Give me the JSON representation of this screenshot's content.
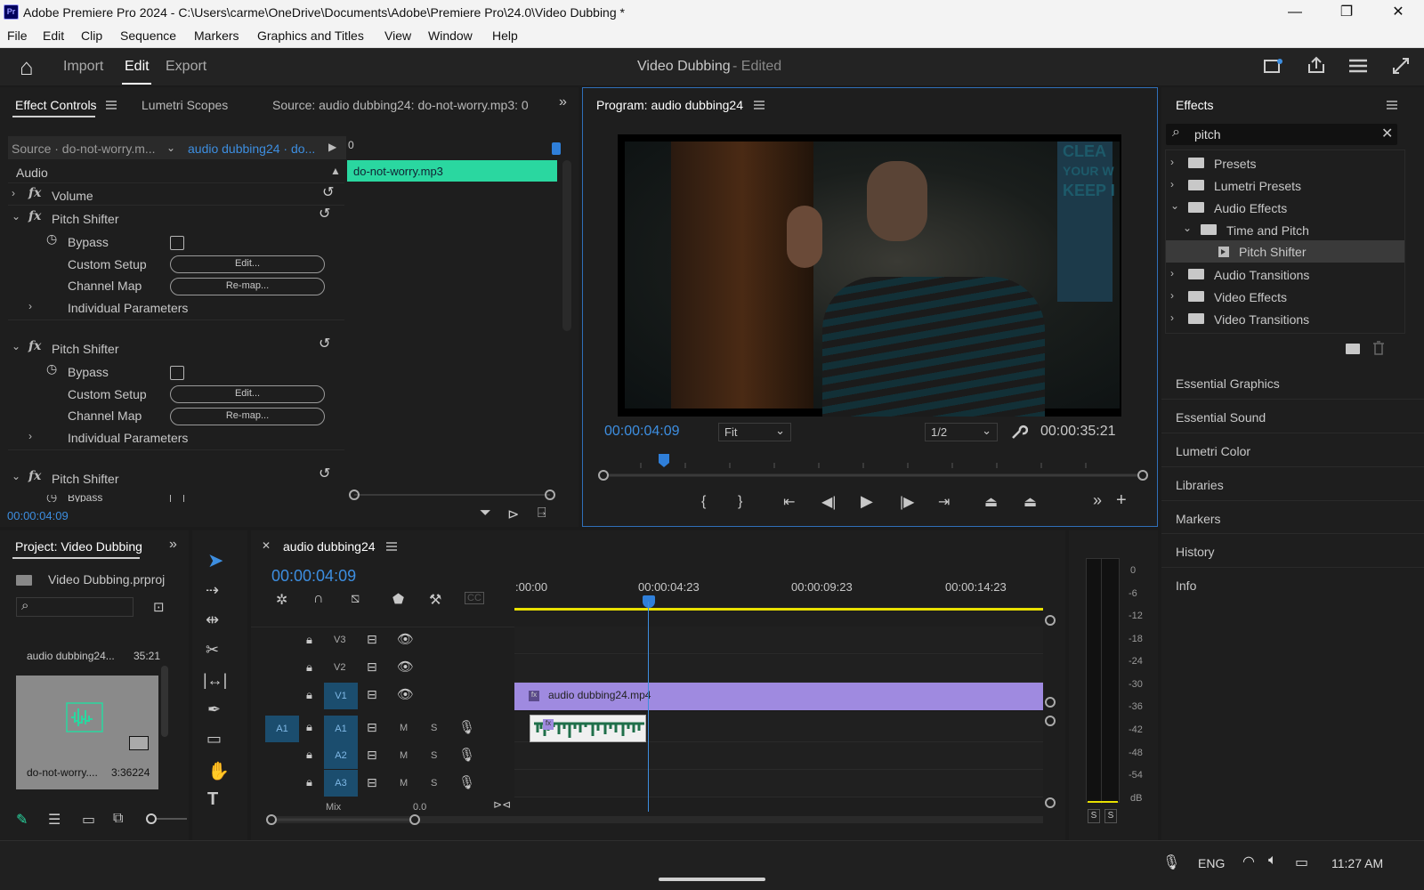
{
  "window": {
    "title": "Adobe Premiere Pro 2024 - C:\\Users\\carme\\OneDrive\\Documents\\Adobe\\Premiere Pro\\24.0\\Video Dubbing *",
    "logo": "Pr",
    "minimize": "—",
    "maximize": "❐",
    "close": "✕"
  },
  "menu": [
    "File",
    "Edit",
    "Clip",
    "Sequence",
    "Markers",
    "Graphics and Titles",
    "View",
    "Window",
    "Help"
  ],
  "header": {
    "home": "⌂",
    "tabs": [
      "Import",
      "Edit",
      "Export"
    ],
    "active_tab": "Edit",
    "project": "Video Dubbing",
    "status": "- Edited"
  },
  "effect_controls": {
    "tabs": [
      "Effect Controls",
      "Lumetri Scopes",
      "Source: audio dubbing24: do-not-worry.mp3: 0"
    ],
    "source_label": "Source · do-not-worry.m...",
    "sequence_label": "audio dubbing24 · do...",
    "ruler_zero": "0",
    "clip_name": "do-not-worry.mp3",
    "section": "Audio",
    "volume": "Volume",
    "pitch": "Pitch Shifter",
    "bypass": "Bypass",
    "custom_setup": "Custom Setup",
    "channel_map": "Channel Map",
    "individual": "Individual Parameters",
    "edit_btn": "Edit...",
    "remap_btn": "Re-map...",
    "bypass_cut": "Bypass",
    "timecode": "00:00:04:09"
  },
  "program": {
    "title": "Program: audio dubbing24",
    "timecode": "00:00:04:09",
    "fit": "Fit",
    "resolution": "1/2",
    "duration": "00:00:35:21",
    "poster_text": [
      "CLEA",
      "YOUR W",
      "KEEP I"
    ]
  },
  "effects": {
    "title": "Effects",
    "search": "pitch",
    "tree": [
      "Presets",
      "Lumetri Presets",
      "Audio Effects",
      "Time and Pitch",
      "Pitch Shifter",
      "Audio Transitions",
      "Video Effects",
      "Video Transitions"
    ],
    "panels": [
      "Essential Graphics",
      "Essential Sound",
      "Lumetri Color",
      "Libraries",
      "Markers",
      "History",
      "Info"
    ]
  },
  "project": {
    "title": "Project: Video Dubbing",
    "file": "Video Dubbing.prproj",
    "items": [
      {
        "name": "audio dubbing24...",
        "dur": "35:21"
      },
      {
        "name": "do-not-worry....",
        "dur": "3:36224"
      }
    ]
  },
  "timeline": {
    "title": "audio dubbing24",
    "timecode": "00:00:04:09",
    "ruler": [
      ":00:00",
      "00:00:04:23",
      "00:00:09:23",
      "00:00:14:23"
    ],
    "video_tracks": [
      "V3",
      "V2",
      "V1"
    ],
    "audio_tracks": [
      "A1",
      "A2",
      "A3"
    ],
    "source_patch": "A1",
    "mix": "Mix",
    "mix_val": "0.0",
    "video_clip": "audio dubbing24.mp4",
    "fx": "fx",
    "m": "M",
    "s": "S"
  },
  "meter": {
    "scale": [
      "0",
      "-6",
      "-12",
      "-18",
      "-24",
      "-30",
      "-36",
      "-42",
      "-48",
      "-54",
      "dB"
    ],
    "solo": "S"
  },
  "taskbar": {
    "lang": "ENG",
    "time": "11:27 AM"
  }
}
